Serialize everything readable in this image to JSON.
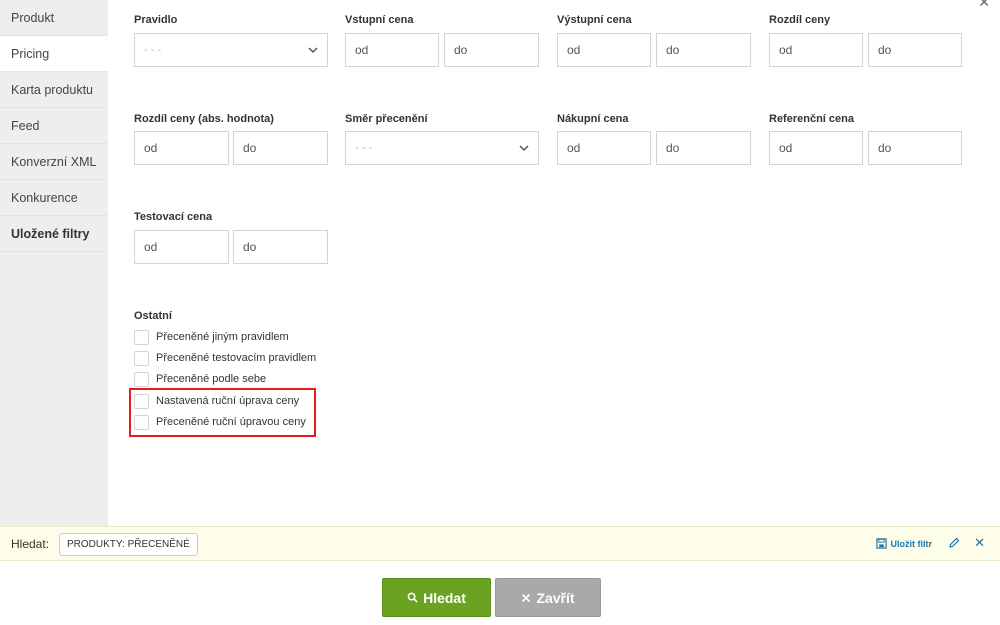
{
  "sidebar": {
    "items": [
      {
        "label": "Produkt"
      },
      {
        "label": "Pricing"
      },
      {
        "label": "Karta produktu"
      },
      {
        "label": "Feed"
      },
      {
        "label": "Konverzní XML"
      },
      {
        "label": "Konkurence"
      },
      {
        "label": "Uložené filtry"
      }
    ]
  },
  "filters": {
    "pravidlo": {
      "label": "Pravidlo",
      "value": "- - -"
    },
    "vstupni_cena": {
      "label": "Vstupní cena",
      "from": "od",
      "to": "do"
    },
    "vystupni_cena": {
      "label": "Výstupní cena",
      "from": "od",
      "to": "do"
    },
    "rozdil_ceny": {
      "label": "Rozdíl ceny",
      "from": "od",
      "to": "do"
    },
    "rozdil_ceny_abs": {
      "label": "Rozdíl ceny (abs. hodnota)",
      "from": "od",
      "to": "do"
    },
    "smer_preceneni": {
      "label": "Směr přecenění",
      "value": "- - -"
    },
    "nakupni_cena": {
      "label": "Nákupní cena",
      "from": "od",
      "to": "do"
    },
    "referencni_cena": {
      "label": "Referenční cena",
      "from": "od",
      "to": "do"
    },
    "testovaci_cena": {
      "label": "Testovací cena",
      "from": "od",
      "to": "do"
    }
  },
  "ostatni": {
    "label": "Ostatní",
    "checkboxes": [
      {
        "label": "Přeceněné jiným pravidlem"
      },
      {
        "label": "Přeceněné testovacím pravidlem"
      },
      {
        "label": "Přeceněné podle sebe"
      },
      {
        "label": "Nastavená ruční úprava ceny"
      },
      {
        "label": "Přeceněné ruční úpravou ceny"
      }
    ]
  },
  "searchbar": {
    "label": "Hledat:",
    "tag": "PRODUKTY: PŘECENĚNÉ",
    "save_label": "Uložit filtr"
  },
  "actions": {
    "search_label": "Hledat",
    "close_label": "Zavřít"
  },
  "colors": {
    "accent": "#1a78b0",
    "search_button": "#6aa322",
    "close_button": "#a9a9a9",
    "highlight": "#e41b23"
  }
}
